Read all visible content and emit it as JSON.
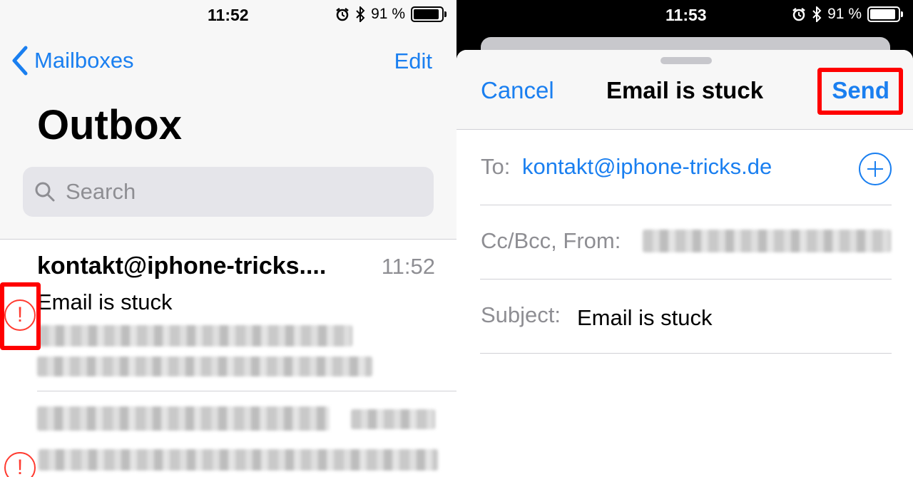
{
  "left": {
    "status": {
      "time": "11:52",
      "battery": "91 %",
      "battery_level": 0.91
    },
    "nav": {
      "back_label": "Mailboxes",
      "edit_label": "Edit"
    },
    "title": "Outbox",
    "search": {
      "placeholder": "Search"
    },
    "messages": [
      {
        "sender": "kontakt@iphone-tricks....",
        "time": "11:52",
        "subject": "Email is stuck"
      }
    ]
  },
  "right": {
    "status": {
      "time": "11:53",
      "battery": "91 %",
      "battery_level": 0.91
    },
    "compose": {
      "cancel_label": "Cancel",
      "title": "Email is stuck",
      "send_label": "Send",
      "to_label": "To:",
      "to_value": "kontakt@iphone-tricks.de",
      "ccbcc_label": "Cc/Bcc, From:",
      "subject_label": "Subject:",
      "subject_value": "Email is stuck"
    }
  },
  "colors": {
    "accent": "#1a7ff0",
    "alert": "#ff3b30",
    "highlight": "#ff0000"
  },
  "icons": [
    "chevron-left-icon",
    "search-icon",
    "alarm-icon",
    "bluetooth-icon",
    "battery-icon",
    "alert-icon",
    "add-contact-icon"
  ]
}
